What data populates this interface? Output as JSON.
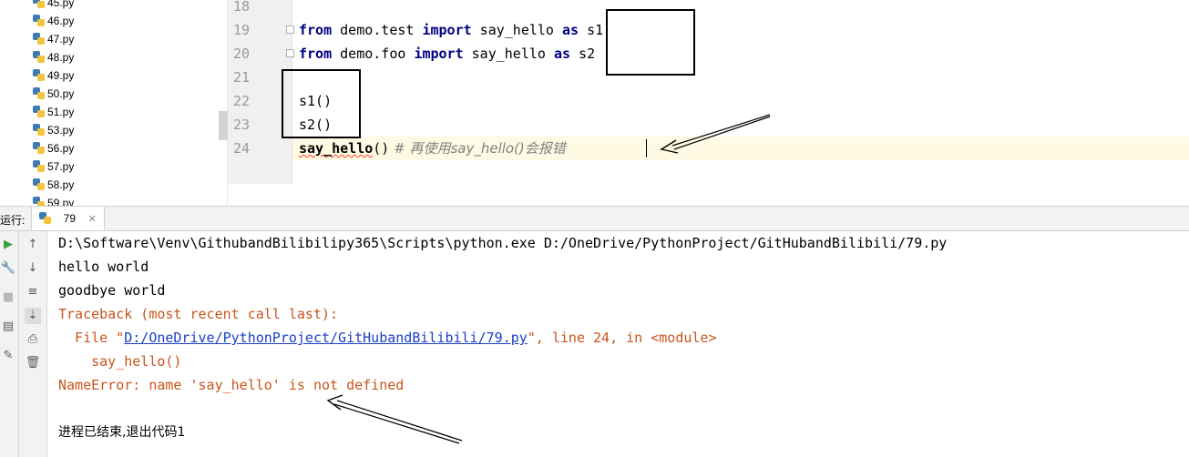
{
  "project_tree": {
    "files": [
      "45.py",
      "46.py",
      "47.py",
      "48.py",
      "49.py",
      "50.py",
      "51.py",
      "53.py",
      "56.py",
      "57.py",
      "58.py",
      "59.py"
    ]
  },
  "editor": {
    "lines": [
      {
        "num": "18"
      },
      {
        "num": "19",
        "t1": "from",
        "t2": " demo.test ",
        "t3": "import",
        "t4": " say_hello ",
        "t5": "as",
        "t6": " s1"
      },
      {
        "num": "20",
        "t1": "from",
        "t2": " demo.foo ",
        "t3": "import",
        "t4": " say_hello ",
        "t5": "as",
        "t6": " s2"
      },
      {
        "num": "21"
      },
      {
        "num": "22",
        "text": "s1()"
      },
      {
        "num": "23",
        "text": "s2()"
      },
      {
        "num": "24",
        "call": "say_hello",
        "parens": "()",
        "comment": " # 再使用say_hello()会报错"
      }
    ]
  },
  "run_panel": {
    "label": "运行:",
    "tab": "79",
    "tab_close": "✕"
  },
  "console": {
    "cmd": "D:\\Software\\Venv\\GithubandBilibilipy365\\Scripts\\python.exe D:/OneDrive/PythonProject/GitHubandBilibili/79.py",
    "out1": "hello world",
    "out2": "goodbye world",
    "traceback": "Traceback (most recent call last):",
    "file_prefix": "  File \"",
    "file_link": "D:/OneDrive/PythonProject/GitHubandBilibili/79.py",
    "file_suffix": "\", line 24, in <module>",
    "code_line": "    say_hello()",
    "error": "NameError: name 'say_hello' is not defined",
    "exit": "进程已结束,退出代码1"
  },
  "colors": {
    "keyword": "#000080",
    "error_text": "#c9541c",
    "link": "#1a40c8",
    "current_line": "#fffae3"
  }
}
